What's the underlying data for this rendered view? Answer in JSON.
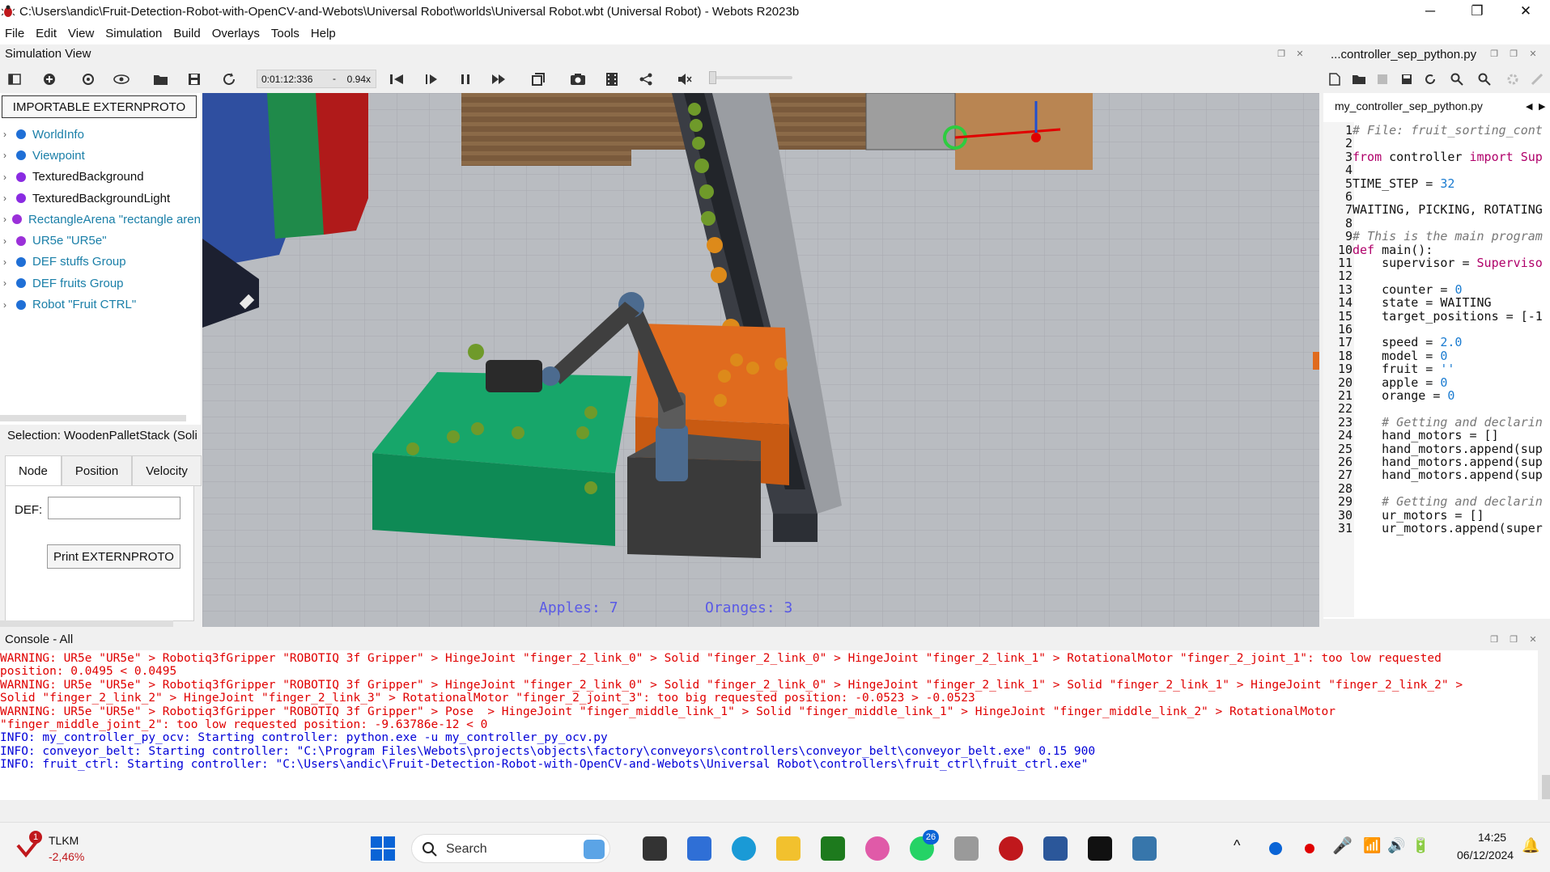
{
  "window": {
    "title": "C:\\Users\\andic\\Fruit-Detection-Robot-with-OpenCV-and-Webots\\Universal Robot\\worlds\\Universal Robot.wbt (Universal Robot) - Webots R2023b",
    "minimize": "─",
    "maximize": "❐",
    "close": "✕"
  },
  "menu": [
    "File",
    "Edit",
    "View",
    "Simulation",
    "Build",
    "Overlays",
    "Tools",
    "Help"
  ],
  "simulation_view": {
    "label": "Simulation View",
    "time": "0:01:12:336",
    "separator": "-",
    "speed": "0.94x"
  },
  "scene_tree": {
    "importable_button": "IMPORTABLE EXTERNPROTO",
    "nodes": [
      {
        "label": "WorldInfo",
        "color": "#1f6fd6",
        "link": true
      },
      {
        "label": "Viewpoint",
        "color": "#1f6fd6",
        "link": true
      },
      {
        "label": "TexturedBackground",
        "color": "#8a2be2",
        "link": false
      },
      {
        "label": "TexturedBackgroundLight",
        "color": "#8a2be2",
        "link": false
      },
      {
        "label": "RectangleArena \"rectangle aren",
        "color": "#9b30d9",
        "link": true
      },
      {
        "label": "UR5e \"UR5e\"",
        "color": "#9b30d9",
        "link": true
      },
      {
        "label": "DEF stuffs Group",
        "color": "#1f6fd6",
        "link": true
      },
      {
        "label": "DEF fruits Group",
        "color": "#1f6fd6",
        "link": true
      },
      {
        "label": "Robot \"Fruit CTRL\"",
        "color": "#1f6fd6",
        "link": true
      }
    ],
    "link_color": "#1a7fa8"
  },
  "selection": {
    "label": "Selection: WoodenPalletStack (Soli",
    "tabs": [
      "Node",
      "Position",
      "Velocity"
    ],
    "active_tab": "Node",
    "def_label": "DEF:",
    "def_value": "",
    "print_button": "Print EXTERNPROTO"
  },
  "overlay": {
    "apples": "Apples: 7",
    "oranges": "Oranges: 3"
  },
  "editor": {
    "header_title": "...controller_sep_python.py",
    "file_tab": "my_controller_sep_python.py",
    "lines": [
      {
        "n": "1",
        "html": "<span class='cm'># File: fruit_sorting_cont</span>"
      },
      {
        "n": "2",
        "html": ""
      },
      {
        "n": "3",
        "html": "<span class='kw'>from</span> controller <span class='kw'>import</span> <span class='kw'>Sup</span>"
      },
      {
        "n": "4",
        "html": ""
      },
      {
        "n": "5",
        "html": "TIME_STEP = <span class='num'>32</span>"
      },
      {
        "n": "6",
        "html": ""
      },
      {
        "n": "7",
        "html": "WAITING, PICKING, ROTATING"
      },
      {
        "n": "8",
        "html": ""
      },
      {
        "n": "9",
        "html": "<span class='cm'># This is the main program</span>"
      },
      {
        "n": "10",
        "html": "<span class='kw'>def</span> main():"
      },
      {
        "n": "11",
        "html": "    supervisor = <span class='kw'>Superviso</span>"
      },
      {
        "n": "12",
        "html": ""
      },
      {
        "n": "13",
        "html": "    counter = <span class='num'>0</span>"
      },
      {
        "n": "14",
        "html": "    state = WAITING"
      },
      {
        "n": "15",
        "html": "    target_positions = [-1"
      },
      {
        "n": "16",
        "html": ""
      },
      {
        "n": "17",
        "html": "    speed = <span class='num'>2.0</span>"
      },
      {
        "n": "18",
        "html": "    model = <span class='num'>0</span>"
      },
      {
        "n": "19",
        "html": "    fruit = <span class='num'>''</span>"
      },
      {
        "n": "20",
        "html": "    apple = <span class='num'>0</span>"
      },
      {
        "n": "21",
        "html": "    orange = <span class='num'>0</span>"
      },
      {
        "n": "22",
        "html": ""
      },
      {
        "n": "23",
        "html": "    <span class='cm'># Getting and declarin</span>"
      },
      {
        "n": "24",
        "html": "    hand_motors = []"
      },
      {
        "n": "25",
        "html": "    hand_motors.append(sup"
      },
      {
        "n": "26",
        "html": "    hand_motors.append(sup"
      },
      {
        "n": "27",
        "html": "    hand_motors.append(sup"
      },
      {
        "n": "28",
        "html": ""
      },
      {
        "n": "29",
        "html": "    <span class='cm'># Getting and declarin</span>"
      },
      {
        "n": "30",
        "html": "    ur_motors = []"
      },
      {
        "n": "31",
        "html": "    ur_motors.append(super"
      }
    ]
  },
  "console": {
    "label": "Console - All",
    "lines": [
      {
        "type": "warn",
        "text": "WARNING: UR5e \"UR5e\" > Robotiq3fGripper \"ROBOTIQ 3f Gripper\" > HingeJoint \"finger_2_link_0\" > Solid \"finger_2_link_0\" > HingeJoint \"finger_2_link_1\" > RotationalMotor \"finger_2_joint_1\": too low requested"
      },
      {
        "type": "warn",
        "text": "position: 0.0495 < 0.0495"
      },
      {
        "type": "warn",
        "text": "WARNING: UR5e \"UR5e\" > Robotiq3fGripper \"ROBOTIQ 3f Gripper\" > HingeJoint \"finger_2_link_0\" > Solid \"finger_2_link_0\" > HingeJoint \"finger_2_link_1\" > Solid \"finger_2_link_1\" > HingeJoint \"finger_2_link_2\" >"
      },
      {
        "type": "warn",
        "text": "Solid \"finger_2_link_2\" > HingeJoint \"finger_2_link_3\" > RotationalMotor \"finger_2_joint_3\": too big requested position: -0.0523 > -0.0523"
      },
      {
        "type": "warn",
        "text": "WARNING: UR5e \"UR5e\" > Robotiq3fGripper \"ROBOTIQ 3f Gripper\" > Pose  > HingeJoint \"finger_middle_link_1\" > Solid \"finger_middle_link_1\" > HingeJoint \"finger_middle_link_2\" > RotationalMotor"
      },
      {
        "type": "warn",
        "text": "\"finger_middle_joint_2\": too low requested position: -9.63786e-12 < 0"
      },
      {
        "type": "info",
        "text": "INFO: my_controller_py_ocv: Starting controller: python.exe -u my_controller_py_ocv.py"
      },
      {
        "type": "info",
        "text": "INFO: conveyor_belt: Starting controller: \"C:\\Program Files\\Webots\\projects\\objects\\factory\\conveyors\\controllers\\conveyor_belt\\conveyor_belt.exe\" 0.15 900"
      },
      {
        "type": "info",
        "text": "INFO: fruit_ctrl: Starting controller: \"C:\\Users\\andic\\Fruit-Detection-Robot-with-OpenCV-and-Webots\\Universal Robot\\controllers\\fruit_ctrl\\fruit_ctrl.exe\""
      }
    ]
  },
  "taskbar": {
    "stock_name": "TLKM",
    "stock_change": "-2,46%",
    "stock_badge": "1",
    "search": "Search",
    "whatsapp_badge": "26",
    "time": "14:25",
    "date": "06/12/2024"
  },
  "colors": {
    "warning": "#e00000",
    "info": "#0000d8",
    "overlay_text": "#5a5ae6"
  }
}
